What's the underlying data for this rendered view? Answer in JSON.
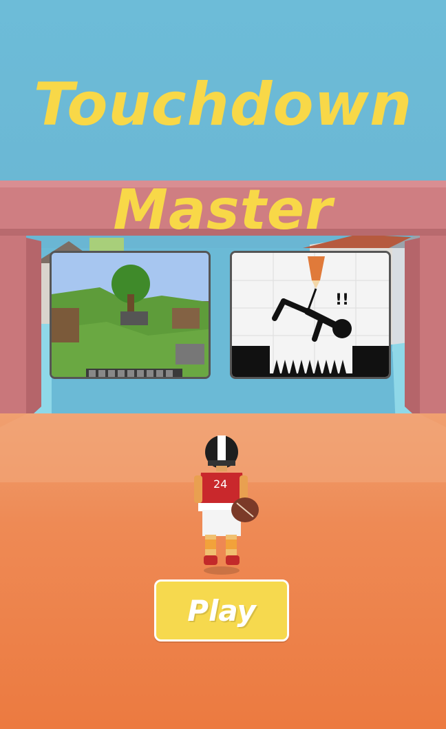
{
  "game": {
    "title_line1": "Touchdown",
    "title_line2": "Master",
    "play_label": "Play",
    "jersey_number": "24"
  },
  "ads": [
    {
      "name": "minecraft-game-ad",
      "description_icon": "blocky-landscape-thumbnail"
    },
    {
      "name": "stickman-draw-game-ad",
      "description_icon": "stickman-pencil-thumbnail"
    }
  ],
  "colors": {
    "title": "#f8d848",
    "play_button": "#f6d94e",
    "goalpost": "#cf7e82",
    "sky": "#6dbcd8",
    "ground": "#ee8a55"
  }
}
